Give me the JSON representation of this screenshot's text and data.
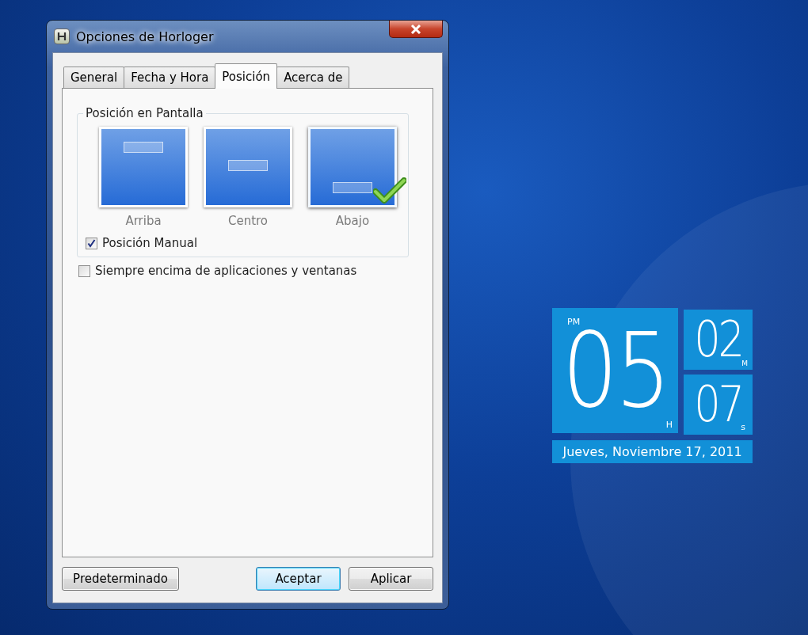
{
  "window": {
    "title": "Opciones de Horloger"
  },
  "tabs": [
    {
      "label": "General",
      "selected": false
    },
    {
      "label": "Fecha y Hora",
      "selected": false
    },
    {
      "label": "Posición",
      "selected": true
    },
    {
      "label": "Acerca de",
      "selected": false
    }
  ],
  "position_group": {
    "title": "Posición en Pantalla",
    "options": [
      {
        "label": "Arriba",
        "kind": "top",
        "selected": false
      },
      {
        "label": "Centro",
        "kind": "center",
        "selected": false
      },
      {
        "label": "Abajo",
        "kind": "bottom",
        "selected": true
      }
    ],
    "manual": {
      "label": "Posición Manual",
      "checked": true
    }
  },
  "always_on_top": {
    "label": "Siempre encima de aplicaciones y ventanas",
    "checked": false
  },
  "buttons": [
    {
      "label": "Predeterminado",
      "default": false
    },
    {
      "label": "Aceptar",
      "default": true
    },
    {
      "label": "Aplicar",
      "default": false
    }
  ],
  "clock": {
    "period": "PM",
    "hours": "05",
    "hours_unit": "H",
    "minutes": "02",
    "minutes_unit": "M",
    "seconds": "07",
    "seconds_unit": "s",
    "date": "Jueves, Noviembre 17, 2011"
  }
}
